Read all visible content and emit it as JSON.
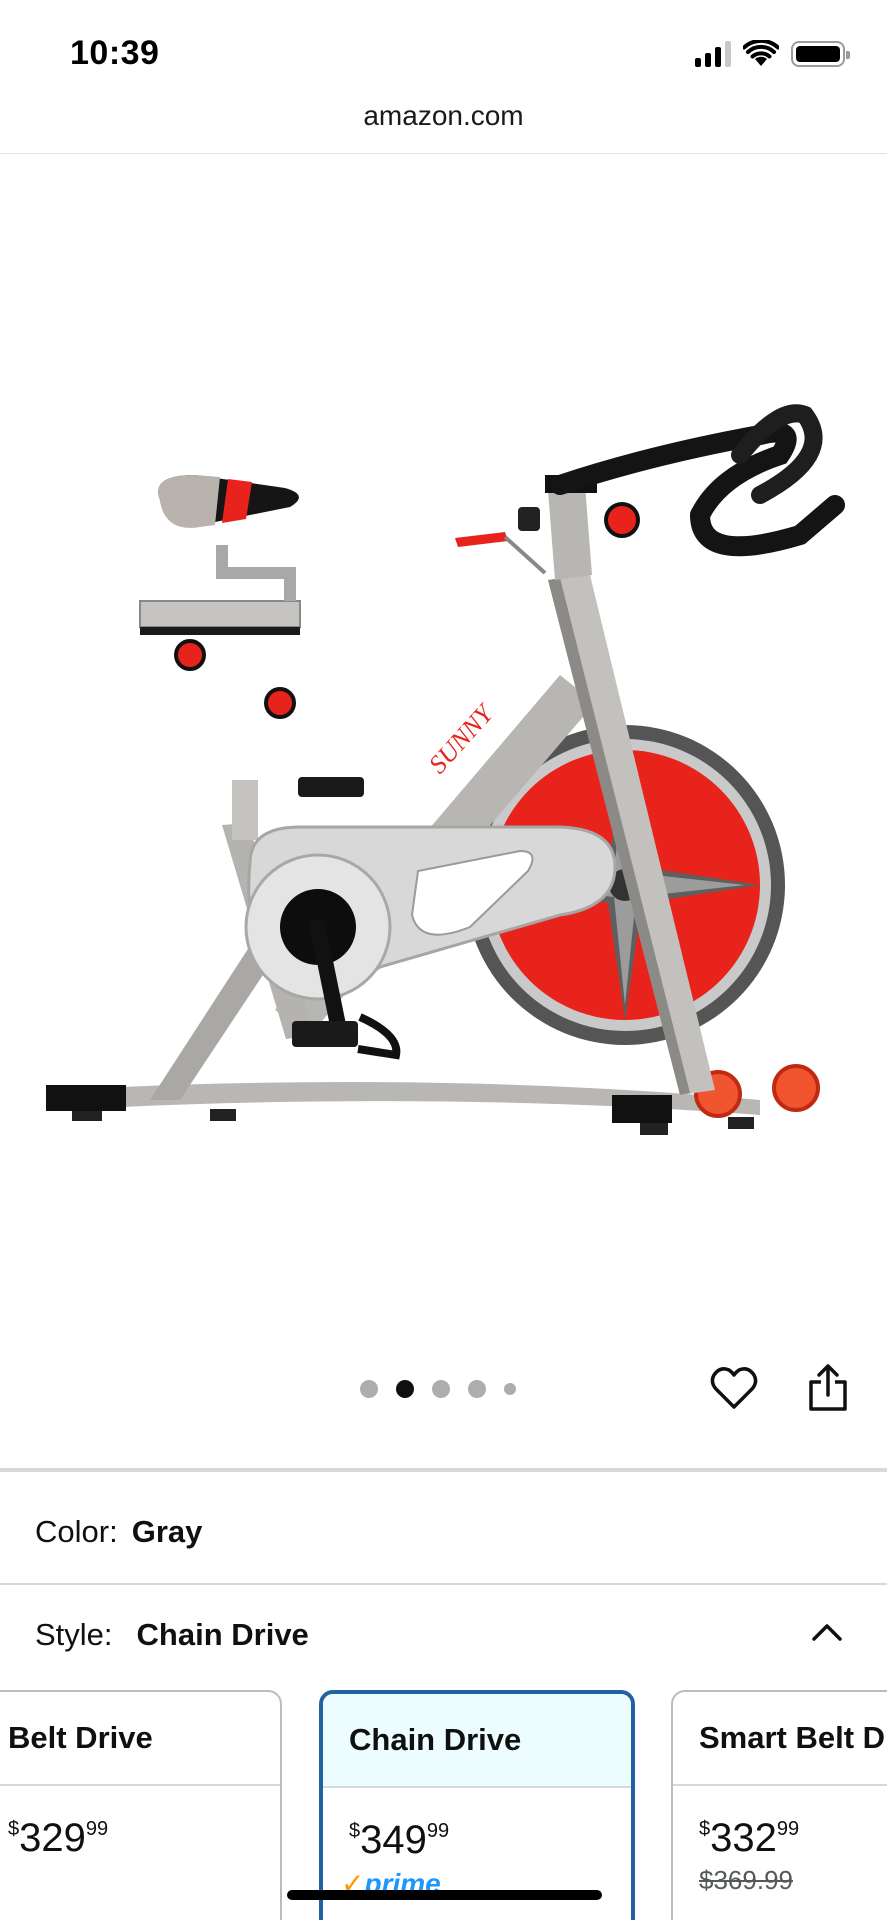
{
  "status_bar": {
    "time": "10:39"
  },
  "browser": {
    "url": "amazon.com"
  },
  "product": {
    "brand_mark": "SUNNY",
    "carousel": {
      "total": 5,
      "active_index": 1
    }
  },
  "options": {
    "color": {
      "label": "Color:",
      "value": "Gray"
    },
    "style": {
      "label": "Style:",
      "value": "Chain Drive"
    }
  },
  "style_cards": [
    {
      "name": "Belt Drive",
      "price_symbol": "$",
      "price_whole": "329",
      "price_frac": "99"
    },
    {
      "name": "Chain Drive",
      "price_symbol": "$",
      "price_whole": "349",
      "price_frac": "99",
      "badge": "prime",
      "selected": true
    },
    {
      "name": "Smart Belt Drive",
      "price_symbol": "$",
      "price_whole": "332",
      "price_frac": "99",
      "list_price": "$369.99"
    }
  ],
  "icons": [
    "signal-icon",
    "wifi-icon",
    "battery-icon",
    "heart-icon",
    "share-icon",
    "chevron-up-icon"
  ],
  "colors": {
    "accent_blue": "#2162a1",
    "prime_blue": "#1a98ff",
    "bike_red": "#e8231c",
    "frame_gray": "#b8b6b2"
  }
}
